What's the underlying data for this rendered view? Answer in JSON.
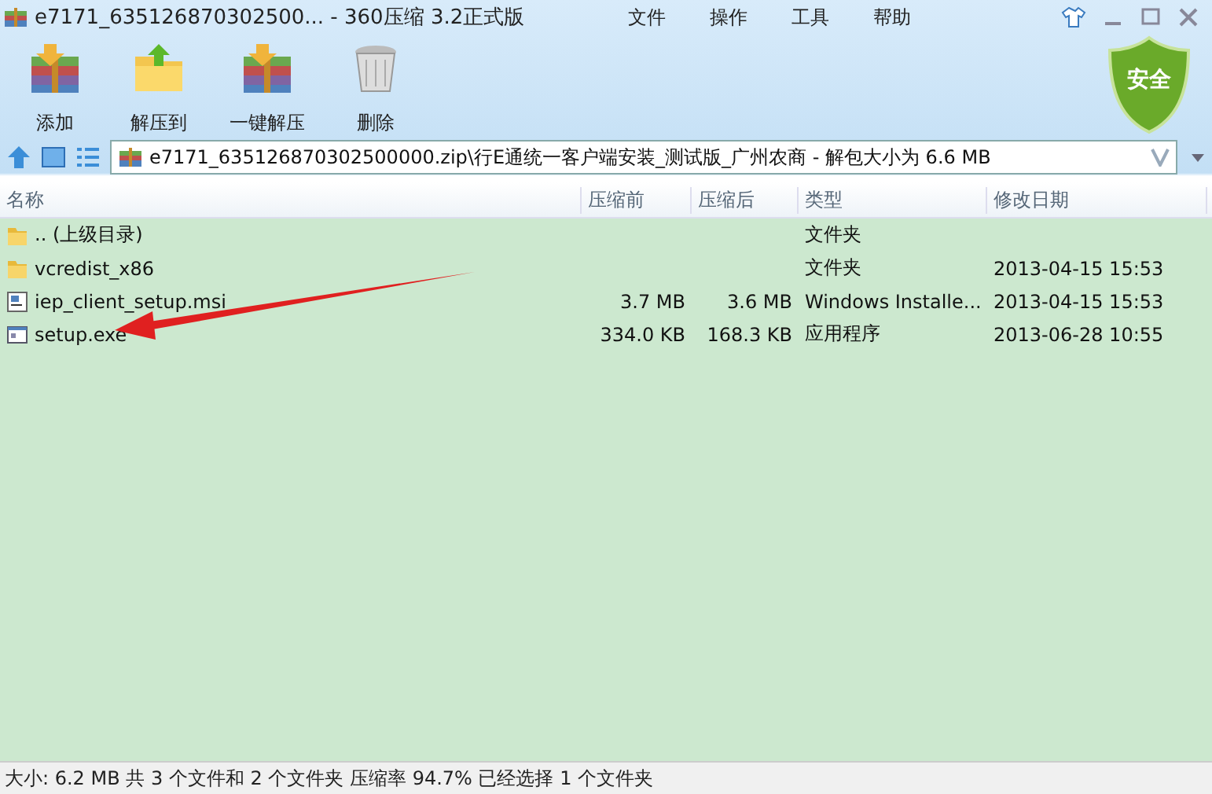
{
  "window": {
    "title": "e7171_635126870302500... - 360压缩 3.2正式版"
  },
  "menu": [
    "文件",
    "操作",
    "工具",
    "帮助"
  ],
  "toolbar": [
    {
      "label": "添加",
      "kind": "archive"
    },
    {
      "label": "解压到",
      "kind": "folder"
    },
    {
      "label": "一键解压",
      "kind": "archive"
    },
    {
      "label": "删除",
      "kind": "trash"
    }
  ],
  "badge": {
    "label": "安全"
  },
  "address": {
    "value": "e7171_635126870302500000.zip\\行E通统一客户端安装_测试版_广州农商 - 解包大小为 6.6 MB"
  },
  "table": {
    "columns": [
      "名称",
      "压缩前",
      "压缩后",
      "类型",
      "修改日期"
    ],
    "rows": [
      {
        "kind": "folder",
        "cells": [
          ".. (上级目录)",
          "",
          "",
          "文件夹",
          ""
        ]
      },
      {
        "kind": "folder",
        "cells": [
          "vcredist_x86",
          "",
          "",
          "文件夹",
          "2013-04-15 15:53"
        ]
      },
      {
        "kind": "msi",
        "cells": [
          "iep_client_setup.msi",
          "3.7 MB",
          "3.6 MB",
          "Windows Installe...",
          "2013-04-15 15:53"
        ]
      },
      {
        "kind": "exe",
        "cells": [
          "setup.exe",
          "334.0 KB",
          "168.3 KB",
          "应用程序",
          "2013-06-28 10:55"
        ]
      }
    ]
  },
  "status_bar": "大小: 6.2 MB 共 3 个文件和 2 个文件夹 压缩率 94.7% 已经选择 1 个文件夹"
}
